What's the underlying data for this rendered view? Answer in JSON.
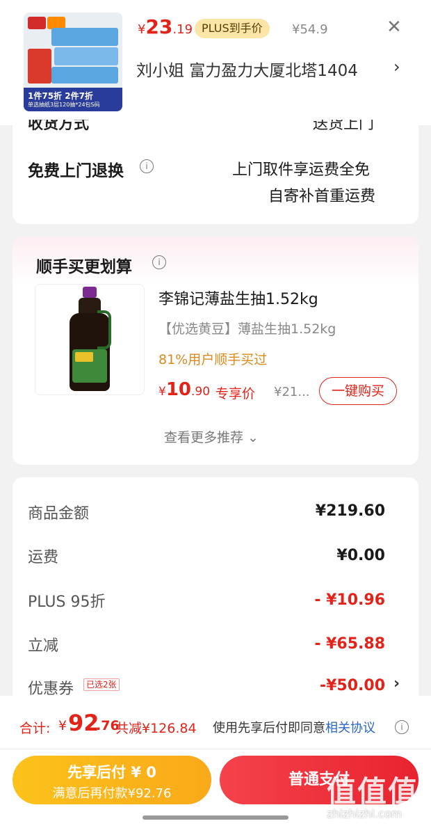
{
  "top_product": {
    "price_currency": "¥",
    "price_int": "23",
    "price_dec": ".19",
    "plus_badge": "PLUS到手价",
    "original_price": "¥54.9",
    "address": "刘小姐  富力盈力大厦北塔1404",
    "promo_text": "1件75折 2件7折",
    "promo_sub": "单选抽纸3层120抽*24包S码"
  },
  "delivery": {
    "partial_label": "收货方式",
    "partial_value": "送货上门"
  },
  "returns": {
    "label": "免费上门退换",
    "value_line1": "上门取件享运费全免",
    "value_line2": "自寄补首重运费"
  },
  "recommend": {
    "title": "顺手买更划算",
    "product_name": "李锦记薄盐生抽1.52kg",
    "product_sub": "【优选黄豆】薄盐生抽1.52kg",
    "buy_rate": "81%用户顺手买过",
    "price_currency": "¥",
    "price_int": "10",
    "price_dec": ".90",
    "exclusive_label": "专享价",
    "original_price": "¥21...",
    "buy_button": "一键购买",
    "more_link": "查看更多推荐 ⌄"
  },
  "summary": {
    "rows": [
      {
        "label": "商品金额",
        "value": "¥219.60"
      },
      {
        "label": "运费",
        "value": "¥0.00"
      },
      {
        "label": "PLUS 95折",
        "value": "- ¥10.96"
      },
      {
        "label": "立减",
        "value": "- ¥65.88"
      },
      {
        "label": "优惠券",
        "value": "-¥50.00"
      }
    ],
    "coupon_tag": "已选2张"
  },
  "footer": {
    "total_label": "合计:",
    "total_currency": "¥",
    "total_int": "92",
    "total_dec": ".76",
    "total_saved": "共减¥126.84",
    "agreement_text": "使用先享后付即同意",
    "agreement_link": "相关协议",
    "btn_later_line1": "先享后付 ¥ 0",
    "btn_later_line2": "满意后再付款¥92.76",
    "btn_pay": "普通支付"
  },
  "watermark": {
    "main": "值值值",
    "sub": "zhizhizhi.com"
  },
  "colors": {
    "accent_red": "#e2231a",
    "plus_gold": "#fbe6a8",
    "later_button": "#f9b21a",
    "link_blue": "#2a66c8"
  }
}
